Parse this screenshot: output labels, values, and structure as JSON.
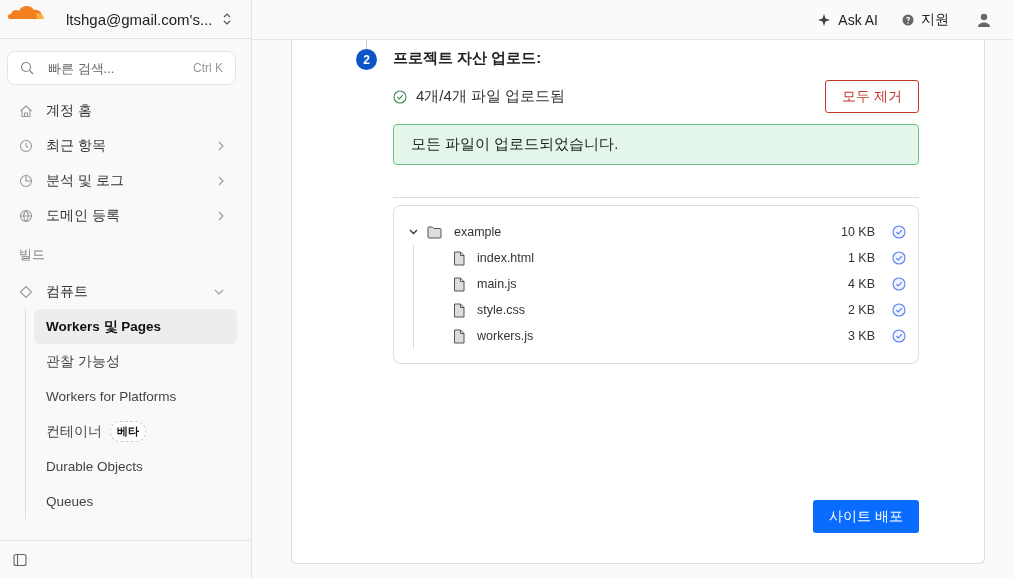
{
  "sidebar": {
    "account": "ltshga@gmail.com's...",
    "search": {
      "placeholder": "빠른 검색...",
      "shortcut": "Ctrl K"
    },
    "items": [
      {
        "label": "계정 홈",
        "expandable": false
      },
      {
        "label": "최근 항목",
        "expandable": true
      },
      {
        "label": "분석 및 로그",
        "expandable": true
      },
      {
        "label": "도메인 등록",
        "expandable": true
      }
    ],
    "section": "빌드",
    "group": {
      "label": "컴퓨트",
      "expanded": true,
      "children": [
        {
          "label": "Workers 및 Pages",
          "selected": true
        },
        {
          "label": "관찰 가능성",
          "selected": false
        },
        {
          "label": "Workers for Platforms",
          "selected": false
        },
        {
          "label": "컨테이너",
          "selected": false,
          "badge": "베타"
        },
        {
          "label": "Durable Objects",
          "selected": false
        },
        {
          "label": "Queues",
          "selected": false
        }
      ]
    }
  },
  "topbar": {
    "ask_ai": "Ask AI",
    "support": "지원"
  },
  "step": {
    "number": "2",
    "title": "프로젝트 자산 업로드:"
  },
  "upload_status": "4개/4개 파일 업로드됨",
  "remove_all": "모두 제거",
  "alert": "모든 파일이 업로드되었습니다.",
  "tree": {
    "name": "example",
    "size": "10 KB",
    "expanded": true,
    "uploaded": true,
    "children": [
      {
        "name": "index.html",
        "size": "1 KB",
        "uploaded": true
      },
      {
        "name": "main.js",
        "size": "4 KB",
        "uploaded": true
      },
      {
        "name": "style.css",
        "size": "2 KB",
        "uploaded": true
      },
      {
        "name": "workers.js",
        "size": "3 KB",
        "uploaded": true
      }
    ]
  },
  "deploy": "사이트 배포"
}
